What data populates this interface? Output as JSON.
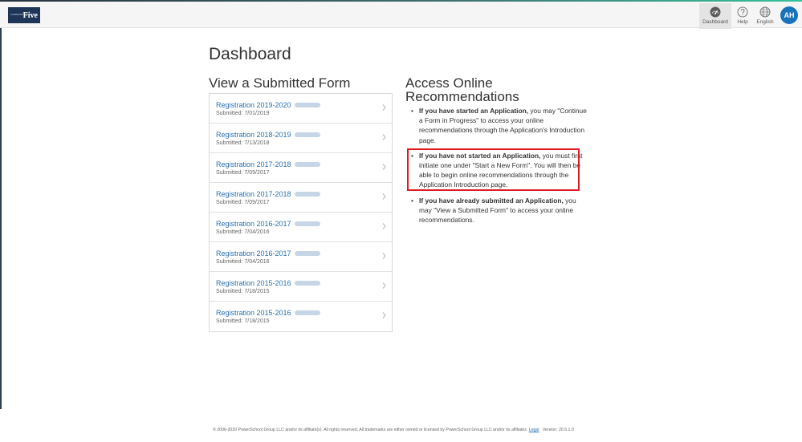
{
  "header": {
    "logo_small_text": "COMMUNITY SCHOOL",
    "logo_text": "Five",
    "nav": [
      {
        "label": "Dashboard",
        "icon": "dashboard-gauge-icon",
        "active": true
      },
      {
        "label": "Help",
        "icon": "help-icon",
        "active": false
      },
      {
        "label": "English",
        "icon": "globe-icon",
        "active": false
      }
    ],
    "avatar_initials": "AH"
  },
  "main": {
    "page_title": "Dashboard",
    "submitted_title": "View a Submitted Form",
    "forms": [
      {
        "name": "Registration 2019-2020",
        "date": "Submitted: 7/01/2019"
      },
      {
        "name": "Registration 2018-2019",
        "date": "Submitted: 7/13/2018"
      },
      {
        "name": "Registration 2017-2018",
        "date": "Submitted: 7/09/2017"
      },
      {
        "name": "Registration 2017-2018",
        "date": "Submitted: 7/09/2017"
      },
      {
        "name": "Registration 2016-2017",
        "date": "Submitted: 7/04/2016"
      },
      {
        "name": "Registration 2016-2017",
        "date": "Submitted: 7/04/2016"
      },
      {
        "name": "Registration 2015-2016",
        "date": "Submitted: 7/18/2015"
      },
      {
        "name": "Registration 2015-2016",
        "date": "Submitted: 7/18/2015"
      }
    ],
    "recommendations_title_line1": "Access Online",
    "recommendations_title_line2": "Recommendations",
    "recommendations": [
      {
        "bold": "If you have started an Application,",
        "text": " you may \"Continue a Form in Progress\" to access your online recommendations through the Application's Introduction page."
      },
      {
        "bold": "If you have not started an Application,",
        "text": " you must first initiate one under \"Start a New Form\". You will then be able to begin online recommendations through the Application Introduction page."
      },
      {
        "bold": "If you have already submitted an Application,",
        "text": " you may \"View a Submitted Form\" to access your online recommendations."
      }
    ]
  },
  "footer": {
    "copyright": "© 2006-2020 PowerSchool Group LLC and/or its affiliate(s). All rights reserved. All trademarks are either owned or licensed by PowerSchool Group LLC and/or its affiliates.",
    "legal_link": "Legal",
    "version": "Version: 20.5.1.0"
  },
  "colors": {
    "link": "#2a70b0",
    "avatar": "#1a72b8",
    "highlight": "#e01a22",
    "logo_bg": "#1e3557"
  }
}
